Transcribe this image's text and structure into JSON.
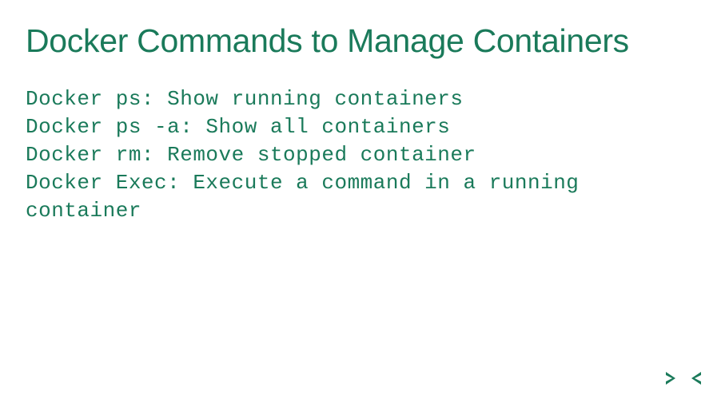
{
  "title": "Docker Commands to Manage Containers",
  "commands": {
    "line1": "Docker ps: Show running containers",
    "line2": "Docker ps -a: Show all containers",
    "line3": "Docker rm: Remove stopped container",
    "line4": "Docker Exec: Execute a command in a running",
    "line5": "container"
  },
  "colors": {
    "primary": "#1a7a5a"
  }
}
